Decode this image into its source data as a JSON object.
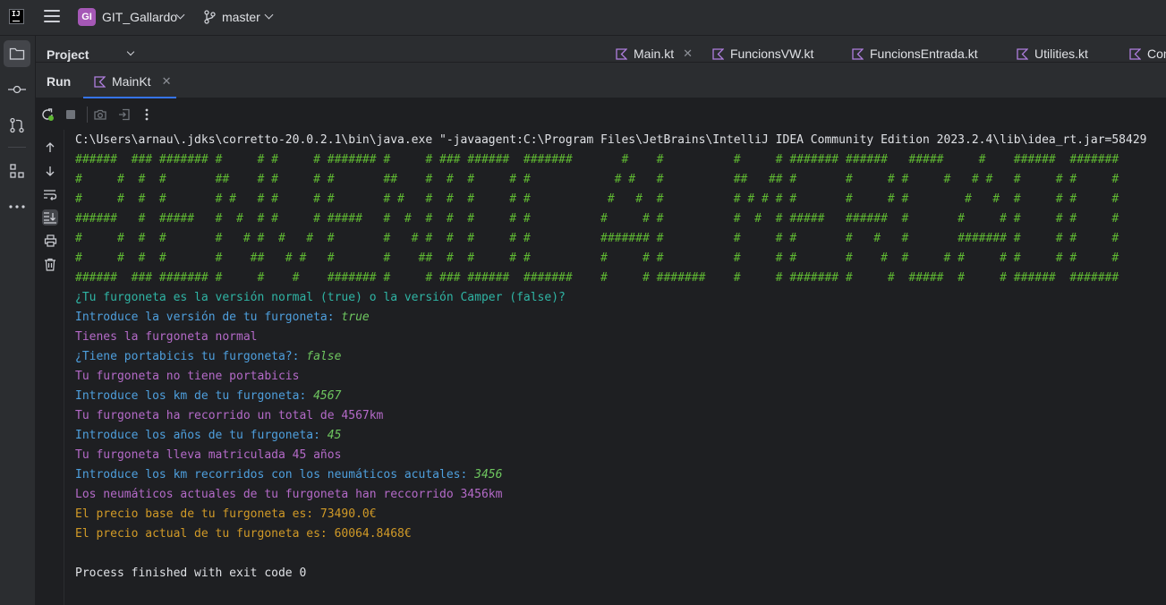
{
  "titlebar": {
    "project_badge": "GI",
    "project_name": "GIT_Gallardo",
    "branch": "master"
  },
  "project_panel": {
    "title": "Project"
  },
  "editor_tabs": [
    {
      "label": "Main.kt",
      "closable": true
    },
    {
      "label": "FuncionsVW.kt"
    },
    {
      "label": "FuncionsEntrada.kt"
    },
    {
      "label": "Utilities.kt"
    },
    {
      "label": "Con"
    }
  ],
  "run_panel": {
    "title": "Run",
    "tab_label": "MainKt"
  },
  "icons": {
    "left_strip": [
      "folder-icon",
      "commit-icon",
      "pull-requests-icon",
      "structure-icon",
      "more-icon"
    ],
    "toolbar": [
      "rerun-icon",
      "stop-icon",
      "camera-icon",
      "exit-icon",
      "more-vertical-icon"
    ],
    "gutter": [
      "arrow-up-icon",
      "arrow-down-icon",
      "soft-wrap-icon",
      "scroll-to-end-icon",
      "print-icon",
      "trash-icon"
    ]
  },
  "colors": {
    "ascii_art": "#5fb832",
    "question": "#2fb4a4",
    "prompt": "#4e9fdd",
    "result": "#b46ac8",
    "price": "#d19a27",
    "accent": "#3574f0"
  },
  "console": {
    "command": "C:\\Users\\arnau\\.jdks\\corretto-20.0.2.1\\bin\\java.exe \"-javaagent:C:\\Program Files\\JetBrains\\IntelliJ IDEA Community Edition 2023.2.4\\lib\\idea_rt.jar=58429",
    "ascii_art": [
      "######  ### ####### #     # #     # ####### #     # ### ######  #######       #    #          #     # ####### ######   #####     #    ######  #######",
      "#     #  #  #       ##    # #     # #       ##    #  #  #     # #            # #   #          ##   ## #       #     # #     #   # #   #     # #     #",
      "#     #  #  #       # #   # #     # #       # #   #  #  #     # #           #   #  #          # # # # #       #     # #        #   #  #     # #     #",
      "######   #  #####   #  #  # #     # #####   #  #  #  #  #     # #          #     # #          #  #  # #####   ######  #       #     # #     # #     #",
      "#     #  #  #       #   # #  #   #  #       #   # #  #  #     # #          ####### #          #     # #       #   #   #       ####### #     # #     #",
      "#     #  #  #       #    ##   # #   #       #    ##  #  #     # #          #     # #          #     # #       #    #  #     # #     # #     # #     #",
      "######  ### ####### #     #    #    ####### #     # ### ######  #######    #     # #######    #     # ####### #     #  #####  #     # ######  #######"
    ],
    "lines": [
      {
        "text": "¿Tu furgoneta es la versión normal (true) o la versión Camper (false)?",
        "style": "cyan",
        "input": ""
      },
      {
        "text": "Introduce la versión de tu furgoneta: ",
        "style": "blue",
        "input": "true"
      },
      {
        "text": "Tienes la furgoneta normal",
        "style": "purple",
        "input": ""
      },
      {
        "text": "¿Tiene portabicis tu furgoneta?: ",
        "style": "blue",
        "input": "false"
      },
      {
        "text": "Tu furgoneta no tiene portabicis",
        "style": "purple",
        "input": ""
      },
      {
        "text": "Introduce los km de tu furgoneta: ",
        "style": "blue",
        "input": "4567"
      },
      {
        "text": "Tu furgoneta ha recorrido un total de 4567km",
        "style": "purple",
        "input": ""
      },
      {
        "text": "Introduce los años de tu furgoneta: ",
        "style": "blue",
        "input": "45"
      },
      {
        "text": "Tu furgoneta lleva matriculada 45 años",
        "style": "purple",
        "input": ""
      },
      {
        "text": "Introduce los km recorridos con los neumáticos acutales: ",
        "style": "blue",
        "input": "3456"
      },
      {
        "text": "Los neumáticos actuales de tu furgoneta han reccorrido 3456km",
        "style": "purple",
        "input": ""
      },
      {
        "text": "El precio base de tu furgoneta es: 73490.0€",
        "style": "orange",
        "input": ""
      },
      {
        "text": "El precio actual de tu furgoneta es: 60064.8468€",
        "style": "orange",
        "input": ""
      }
    ],
    "exit_message": "Process finished with exit code 0"
  }
}
